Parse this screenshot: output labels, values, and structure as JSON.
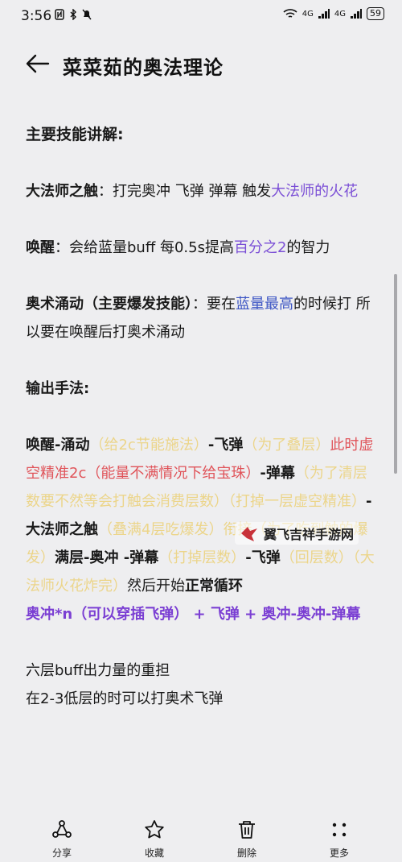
{
  "status_bar": {
    "time": "3:56",
    "network_left": "4G",
    "network_right": "4G",
    "battery": "59"
  },
  "header": {
    "title": "菜菜茹的奥法理论"
  },
  "content": {
    "heading_main": "主要技能讲解:",
    "p1": {
      "a": "大法师之触",
      "b": "：打完奥冲 飞弹 弹幕 触发",
      "c": "大法师的火花"
    },
    "p2": {
      "a": "唤醒",
      "b": "：会给蓝量buff 每0.5s提高",
      "c": "百分之2",
      "d": "的智力"
    },
    "p3": {
      "a": "奥术涌动（主要爆发技能）",
      "b": "：要在",
      "c": "蓝量最高",
      "d": "的时候打 所以要在唤醒后打奥术涌动"
    },
    "heading_output": "输出手法:",
    "p5": {
      "s1": "唤醒-涌动",
      "s2": "（给2c节能施法）",
      "s3": "-飞弹",
      "s4": "（为了叠层）",
      "s5": "此时虚空精准2c",
      "s6": "（能量不满情况下给宝珠）",
      "s7": "-弹幕",
      "s8": "（为了清层数要不然等会打触会消费层数）",
      "s9": "（打掉一层虚空精准）",
      "s10": "-大法师之触",
      "s11": "（叠满4层吃爆发）",
      "s12": "衔接（为了吃到触的爆发）",
      "s13": "满层-奥冲 -弹幕",
      "s14": "（打掉层数）",
      "s15": "-飞弹",
      "s16": "（回层数）",
      "s17": "（大法师火花炸完）",
      "s18": "然后开始",
      "s19": "正常循环"
    },
    "p6": "奥冲*n（可以穿插飞弹） + 飞弹 + 奥冲-奥冲-弹幕",
    "p7": "六层buff出力量的重担",
    "p8": "在2-3低层的时可以打奥术飞弹"
  },
  "watermark": {
    "text": "翼飞吉祥手游网"
  },
  "bottom_bar": {
    "share": "分享",
    "favorite": "收藏",
    "delete": "删除",
    "more": "更多"
  }
}
